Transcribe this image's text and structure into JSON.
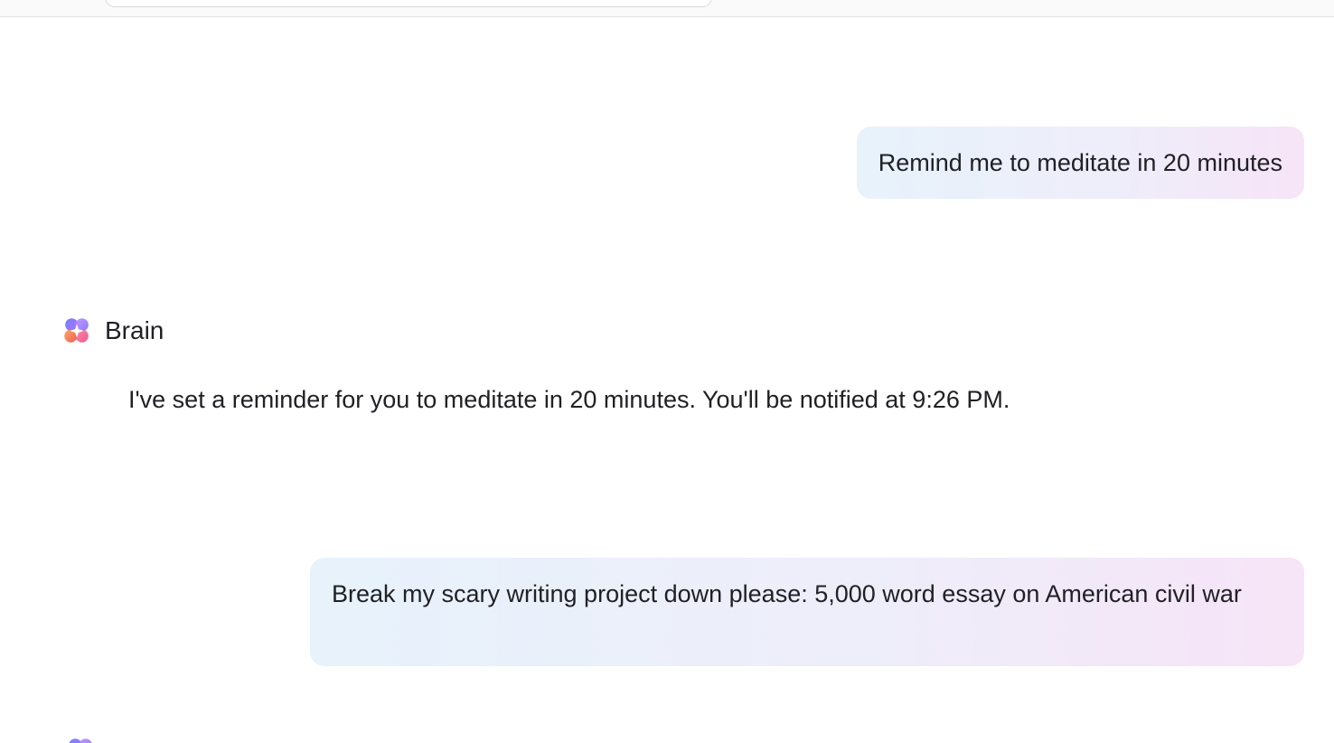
{
  "messages": [
    {
      "role": "user",
      "text": "Remind me to meditate in 20 minutes"
    },
    {
      "role": "assistant",
      "name": "Brain",
      "icon": "brain-logo-icon",
      "text": "I've set a reminder for you to meditate in 20 minutes. You'll be notified at 9:26 PM."
    },
    {
      "role": "user",
      "text": "Break my scary writing project down please: 5,000 word essay on American civil war"
    },
    {
      "role": "assistant",
      "icon": "brain-logo-icon"
    }
  ],
  "colors": {
    "user_bubble_start": "#e7f2fb",
    "user_bubble_end": "#f6e4f7",
    "text": "#202125"
  }
}
